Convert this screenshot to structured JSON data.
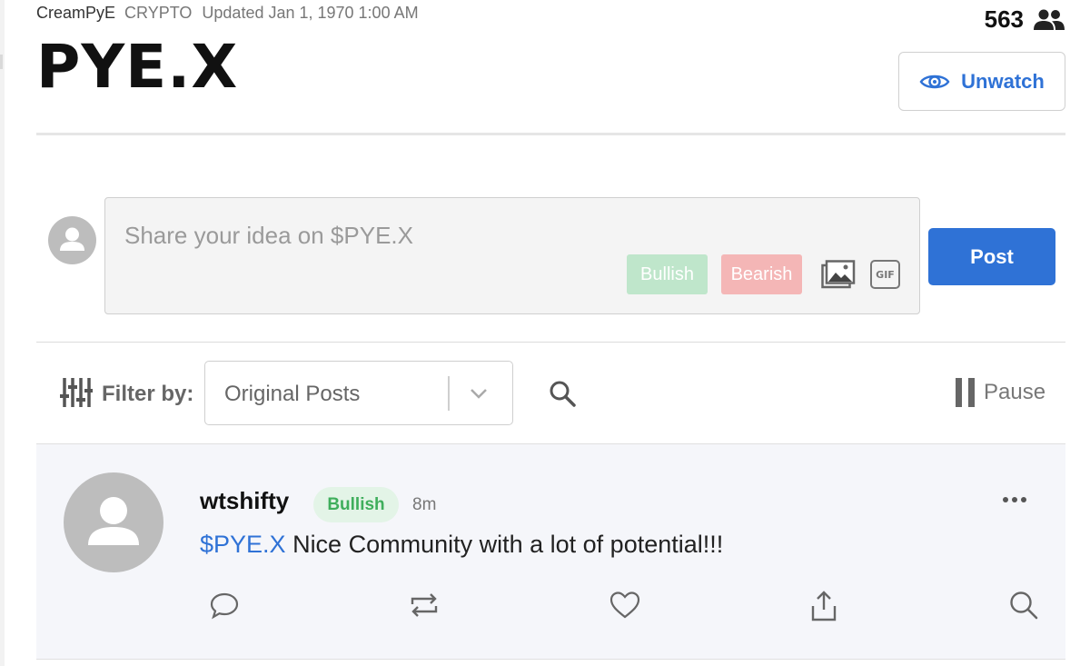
{
  "header": {
    "company_name": "CreamPyE",
    "asset_type": "CRYPTO",
    "updated_text": "Updated Jan 1, 1970 1:00 AM",
    "ticker": "PYE.X",
    "watchers_count": "563",
    "watchers_icon": "users-icon",
    "unwatch_label": "Unwatch",
    "unwatch_icon": "eye-icon"
  },
  "composer": {
    "avatar_icon": "user-avatar-icon",
    "placeholder": "Share your idea on $PYE.X",
    "bullish_label": "Bullish",
    "bearish_label": "Bearish",
    "image_icon": "image-icon",
    "gif_label": "GIF",
    "post_label": "Post"
  },
  "filter": {
    "icon": "sliders-icon",
    "label": "Filter by:",
    "selected": "Original Posts",
    "search_icon": "search-icon",
    "pause_label": "Pause"
  },
  "post": {
    "avatar_icon": "user-avatar-icon",
    "username": "wtshifty",
    "sentiment": "Bullish",
    "time": "8m",
    "cashtag": "$PYE.X",
    "text": " Nice Community with a lot of potential!!!",
    "actions": [
      "comment-icon",
      "repost-icon",
      "like-icon",
      "share-icon",
      "search-icon"
    ]
  },
  "colors": {
    "accent": "#2f72d6",
    "bullish": "#3fae5c",
    "bullish_bg": "#e3f4e7",
    "bullish_tag": "#bfe6cb",
    "bearish_tag": "#f4b6b6",
    "card_bg": "#f5f6fa"
  }
}
